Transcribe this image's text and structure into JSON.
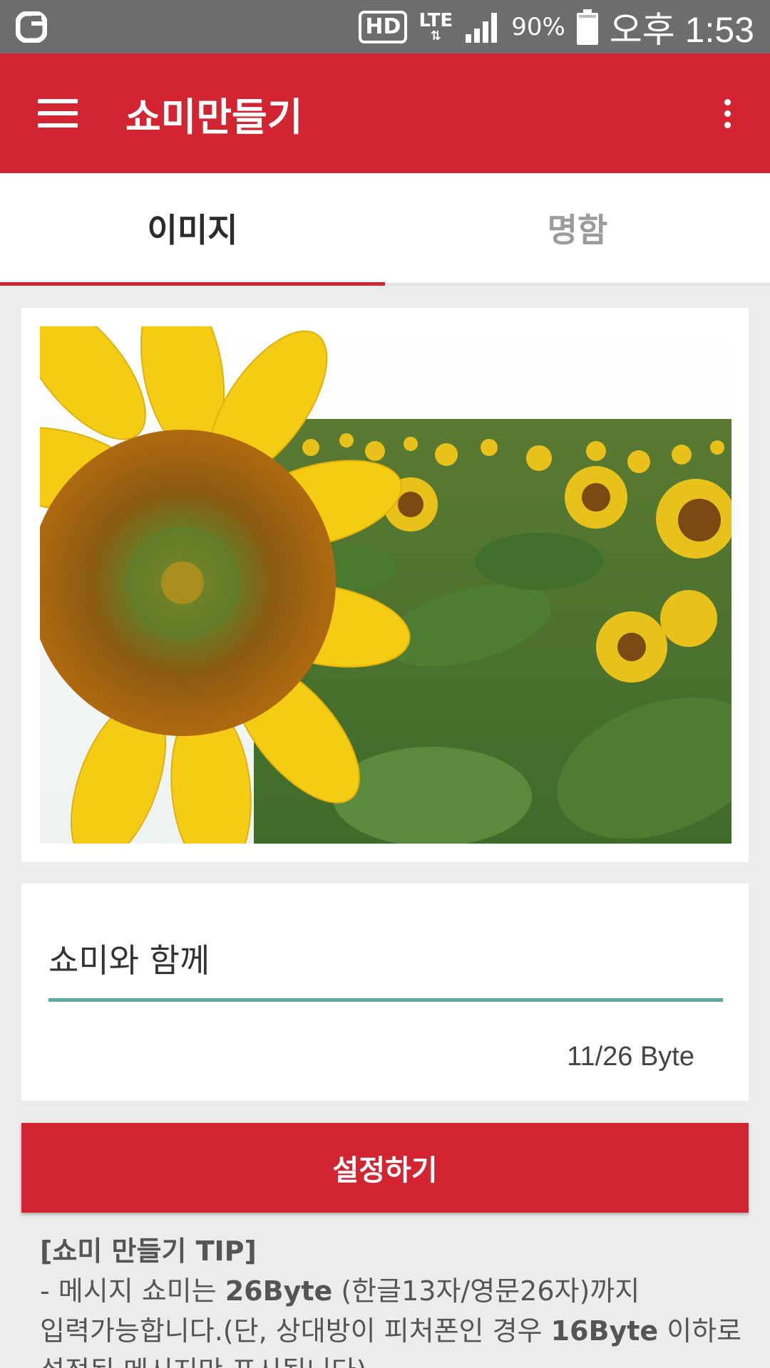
{
  "status_bar": {
    "hd": "HD",
    "network": "LTE",
    "battery": "90%",
    "time": "오후 1:53",
    "colors": {
      "background": "#6d6d6d"
    }
  },
  "app_bar": {
    "title": "쇼미만들기",
    "color": "#d32432"
  },
  "tabs": [
    {
      "label": "이미지",
      "active": true
    },
    {
      "label": "명함",
      "active": false
    }
  ],
  "image": {
    "description_icon": "sunflower-photo"
  },
  "message": {
    "value": "쇼미와 함께",
    "placeholder": "",
    "byte_count": "11/26 Byte",
    "accent": "#5ba9a4"
  },
  "set_button": {
    "label": "설정하기"
  },
  "tips": {
    "title": "[쇼미 만들기 TIP]",
    "line1_a": "- 메시지 쇼미는 ",
    "line1_b": "26Byte",
    "line1_c": " (한글13자/영문26자)까지",
    "line2_a": "입력가능합니다.(단, 상대방이 피처폰인 경우 ",
    "line2_b": "16Byte",
    "line2_c": " 이하로",
    "line3": "설정된 메시지만 표시됩니다)"
  }
}
